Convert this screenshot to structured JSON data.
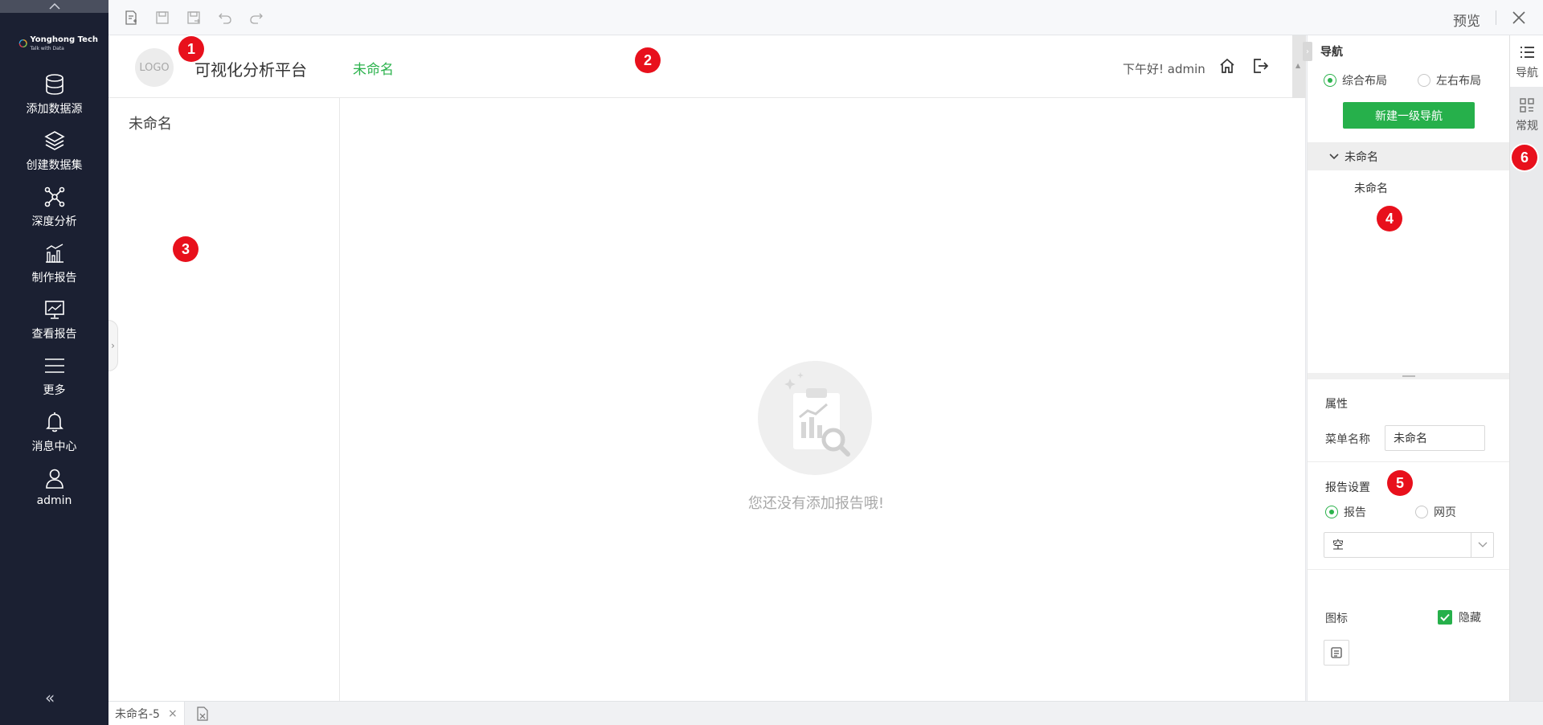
{
  "sidebar": {
    "brand_name": "Yonghong Tech",
    "brand_tagline": "Talk with Data",
    "items": [
      {
        "label": "添加数据源",
        "icon": "database-icon"
      },
      {
        "label": "创建数据集",
        "icon": "layers-icon"
      },
      {
        "label": "深度分析",
        "icon": "network-icon"
      },
      {
        "label": "制作报告",
        "icon": "bar-chart-icon"
      },
      {
        "label": "查看报告",
        "icon": "monitor-chart-icon"
      },
      {
        "label": "更多",
        "icon": "menu-icon"
      },
      {
        "label": "消息中心",
        "icon": "bell-icon"
      },
      {
        "label": "admin",
        "icon": "user-icon"
      }
    ]
  },
  "toolbar": {
    "icons": [
      "new-doc-icon",
      "save-icon",
      "save-as-icon",
      "undo-icon",
      "redo-icon"
    ],
    "preview_label": "预览"
  },
  "canvas": {
    "logo_text": "LOGO",
    "app_title": "可视化分析平台",
    "top_nav_item": "未命名",
    "greeting": "下午好! admin",
    "left_menu_item": "未命名",
    "empty_text": "您还没有添加报告哦!"
  },
  "bottom_bar": {
    "tab_label": "未命名-5"
  },
  "right_panel": {
    "nav_title": "导航",
    "layout_options": [
      "综合布局",
      "左右布局"
    ],
    "layout_selected": "综合布局",
    "new_nav_button": "新建一级导航",
    "tree_parent": "未命名",
    "tree_child": "未命名",
    "properties_title": "属性",
    "menu_name_label": "菜单名称",
    "menu_name_value": "未命名",
    "report_settings_title": "报告设置",
    "report_type_options": [
      "报告",
      "网页"
    ],
    "report_type_selected": "报告",
    "report_select_value": "空",
    "icon_label": "图标",
    "hide_label": "隐藏",
    "hide_checked": true
  },
  "side_tabs": [
    {
      "label": "导航",
      "icon": "list-icon",
      "active": true
    },
    {
      "label": "常规",
      "icon": "grid-icon",
      "active": false
    }
  ],
  "markers": [
    "1",
    "2",
    "3",
    "4",
    "5",
    "6"
  ],
  "colors": {
    "sidebar_bg": "#1b2032",
    "accent_green": "#26b04b",
    "marker_red": "#e8101c"
  }
}
